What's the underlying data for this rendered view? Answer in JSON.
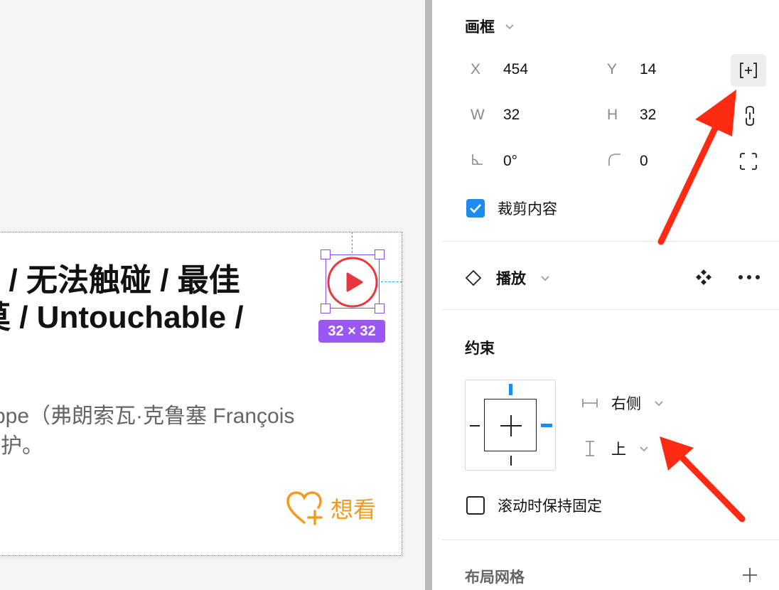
{
  "canvas": {
    "title_lines": [
      "·) / 无法触碰 / 最佳",
      "莫 / Untouchable /"
    ],
    "desc_lines": [
      "ilippe（弗朗索瓦·克鲁塞 François",
      "陪护。"
    ],
    "size_badge": "32 × 32",
    "want_label": "想看"
  },
  "inspector": {
    "frame": {
      "title": "画框",
      "x_label": "X",
      "x_value": "454",
      "y_label": "Y",
      "y_value": "14",
      "w_label": "W",
      "w_value": "32",
      "h_label": "H",
      "h_value": "32",
      "rotation_value": "0°",
      "radius_value": "0",
      "clip_label": "裁剪内容",
      "clip_checked": true
    },
    "component": {
      "name": "播放"
    },
    "constraints": {
      "title": "约束",
      "horizontal": "右侧",
      "vertical": "上",
      "fixed_scroll_label": "滚动时保持固定",
      "fixed_scroll_checked": false
    },
    "layout_grid": {
      "title": "布局网格"
    }
  },
  "colors": {
    "accent": "#1b8cf2",
    "selection": "#8a4dea",
    "badge": "#9b57f5",
    "want": "#f29b1e",
    "play": "#e8373e",
    "annotation_arrow": "#ff2a12"
  }
}
